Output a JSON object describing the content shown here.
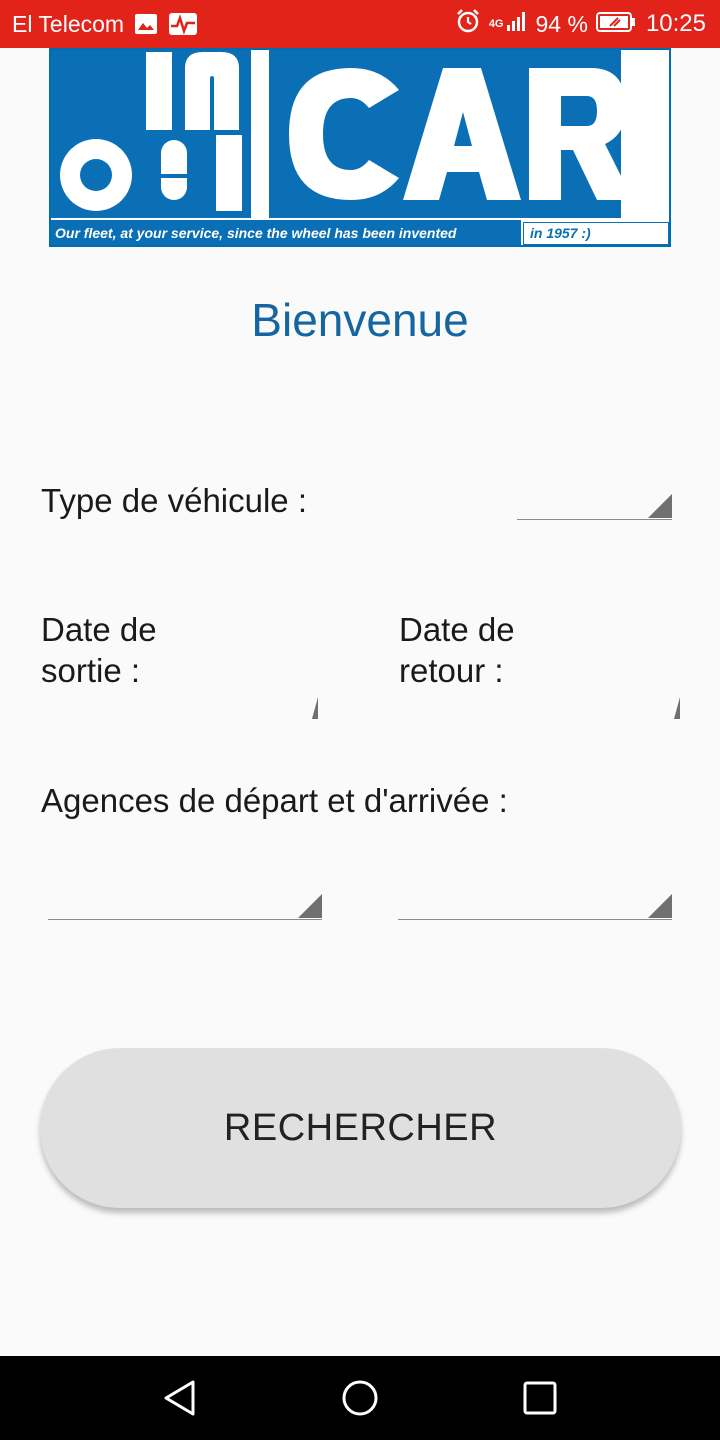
{
  "status_bar": {
    "carrier": "El Telecom",
    "network": "4G",
    "battery": "94 %",
    "time": "10:25",
    "icons": [
      "gallery-icon",
      "pulse-app-icon",
      "alarm-icon",
      "signal-icon",
      "battery-icon"
    ],
    "color": "#e2231a"
  },
  "logo": {
    "brand_small_top": "IN",
    "brand_small_bottom": "OUI",
    "brand_main": "CAR",
    "tagline": "Our fleet, at your service, since the wheel has been invented",
    "tagline_year": "in 1957 :)",
    "color": "#0b6fb6"
  },
  "welcome": "Bienvenue",
  "form": {
    "vehicle_type_label": "Type de véhicule :",
    "departure_date_label_line1": "Date de",
    "departure_date_label_line2": "sortie :",
    "return_date_label_line1": "Date de",
    "return_date_label_line2": "retour :",
    "agencies_label": "Agences de départ et d'arrivée :"
  },
  "search_button": "RECHERCHER",
  "nav_bar": {
    "icons": [
      "back-icon",
      "home-icon",
      "recents-icon"
    ]
  }
}
